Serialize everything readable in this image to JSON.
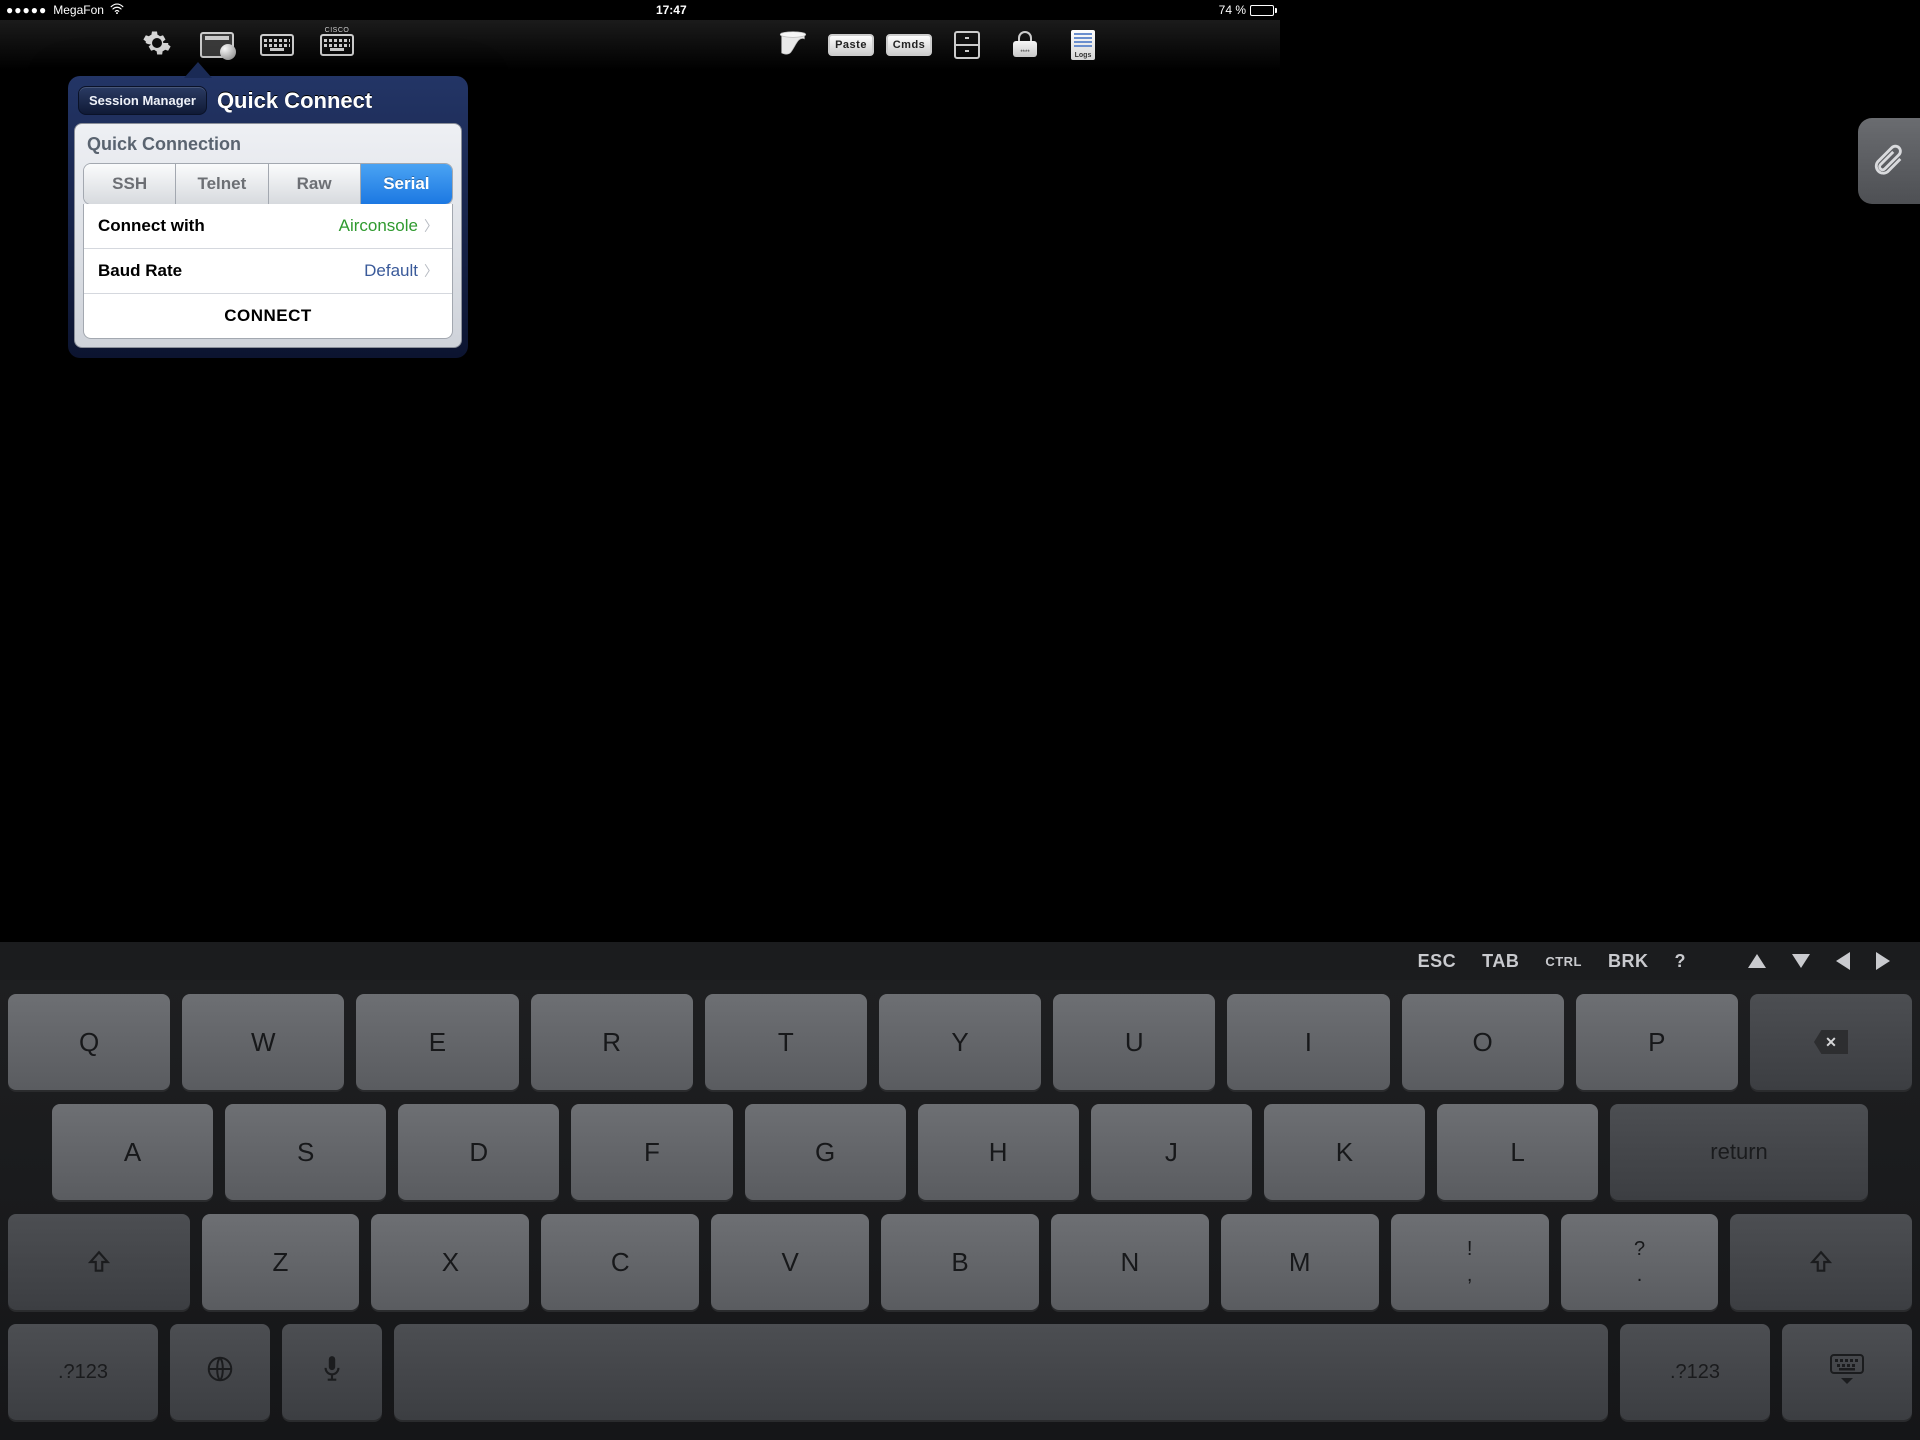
{
  "status": {
    "carrier": "MegaFon",
    "time": "17:47",
    "battery": "74 %"
  },
  "toolbar": {
    "paste": "Paste",
    "cmds": "Cmds",
    "logs": "Logs",
    "cisco": "CISCO",
    "lockdots": "****"
  },
  "popover": {
    "back": "Session Manager",
    "title": "Quick Connect",
    "section": "Quick Connection",
    "tabs": [
      "SSH",
      "Telnet",
      "Raw",
      "Serial"
    ],
    "row1_label": "Connect with",
    "row1_value": "Airconsole",
    "row2_label": "Baud Rate",
    "row2_value": "Default",
    "connect": "CONNECT"
  },
  "accessory": {
    "esc": "ESC",
    "tab": "TAB",
    "ctrl": "CTRL",
    "brk": "BRK",
    "q": "?"
  },
  "kb": {
    "r1": [
      "Q",
      "W",
      "E",
      "R",
      "T",
      "Y",
      "U",
      "I",
      "O",
      "P"
    ],
    "r2": [
      "A",
      "S",
      "D",
      "F",
      "G",
      "H",
      "J",
      "K",
      "L"
    ],
    "return": "return",
    "r3": [
      "Z",
      "X",
      "C",
      "V",
      "B",
      "N",
      "M"
    ],
    "p1_top": "!",
    "p1_bot": ",",
    "p2_top": "?",
    "p2_bot": ".",
    "num": ".?123"
  }
}
